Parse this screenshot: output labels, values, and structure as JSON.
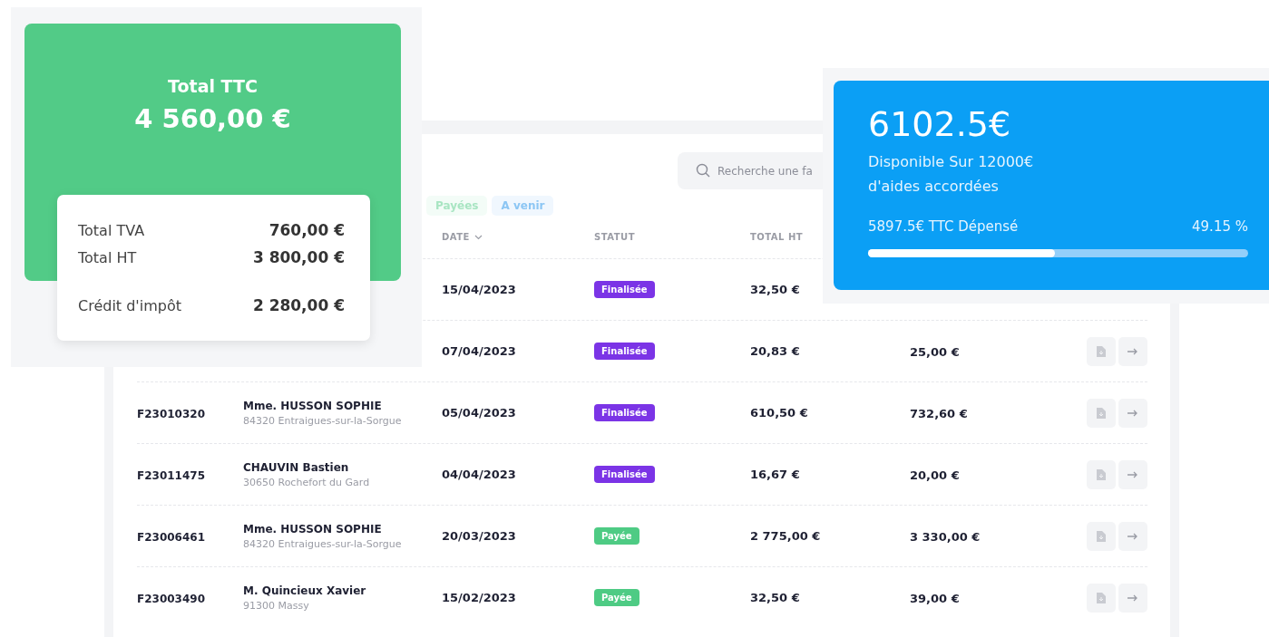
{
  "invoices": {
    "search": {
      "placeholder": "Recherche une fa"
    },
    "filters": [
      {
        "label": "Payées",
        "color": "#a8e5c2"
      },
      {
        "label": "A venir",
        "color": "#8cc6f4"
      }
    ],
    "columns": [
      {
        "label": "DATE",
        "sortable": true
      },
      {
        "label": "STATUT",
        "sortable": false
      },
      {
        "label": "TOTAL HT",
        "sortable": false
      }
    ],
    "rows": [
      {
        "date": "15/04/2023",
        "status": {
          "label": "Finalisée",
          "kind": "finalized"
        },
        "total_ht": "32,50 €"
      },
      {
        "date": "07/04/2023",
        "status": {
          "label": "Finalisée",
          "kind": "finalized"
        },
        "total_ht": "20,83 €",
        "total_ttc": "25,00 €",
        "actions": true
      },
      {
        "reference": "F23010320",
        "client": "Mme. HUSSON SOPHIE",
        "address": "84320 Entraigues-sur-la-Sorgue",
        "date": "05/04/2023",
        "status": {
          "label": "Finalisée",
          "kind": "finalized"
        },
        "total_ht": "610,50 €",
        "total_ttc": "732,60 €",
        "actions": true
      },
      {
        "reference": "F23011475",
        "client": "CHAUVIN Bastien",
        "address": "30650 Rochefort du Gard",
        "date": "04/04/2023",
        "status": {
          "label": "Finalisée",
          "kind": "finalized"
        },
        "total_ht": "16,67 €",
        "total_ttc": "20,00 €",
        "actions": true
      },
      {
        "reference": "F23006461",
        "client": "Mme. HUSSON SOPHIE",
        "address": "84320 Entraigues-sur-la-Sorgue",
        "date": "20/03/2023",
        "status": {
          "label": "Payée",
          "kind": "paid"
        },
        "total_ht": "2 775,00 €",
        "total_ttc": "3 330,00 €",
        "actions": true
      },
      {
        "reference": "F23003490",
        "client": "M. Quincieux Xavier",
        "address": "91300 Massy",
        "date": "15/02/2023",
        "status": {
          "label": "Payée",
          "kind": "paid"
        },
        "total_ht": "32,50 €",
        "total_ttc": "39,00 €",
        "actions": true
      }
    ]
  },
  "totals": {
    "title": "Total TTC",
    "amount": "4 560,00 €",
    "detail_groups": [
      [
        {
          "label": "Total TVA",
          "value": "760,00 €"
        },
        {
          "label": "Total HT",
          "value": "3 800,00 €"
        }
      ],
      [
        {
          "label": "Crédit d'impôt",
          "value": "2 280,00 €"
        }
      ]
    ]
  },
  "budget": {
    "available": "6102.5€",
    "caption_1": "Disponible Sur 12000€",
    "caption_2": "d'aides accordées",
    "spent": "5897.5€ TTC Dépensé",
    "percent": "49.15 %",
    "level": 0.4915
  }
}
